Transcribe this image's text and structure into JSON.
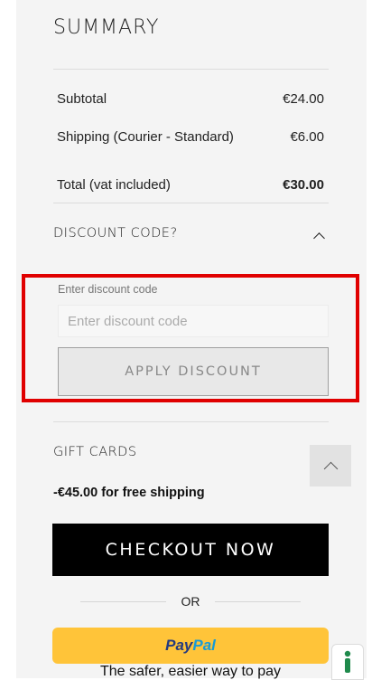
{
  "summary": {
    "title": "SUMMARY",
    "rows": [
      {
        "label": "Subtotal",
        "value": "€24.00"
      },
      {
        "label": "Shipping (Courier - Standard)",
        "value": "€6.00"
      }
    ],
    "total": {
      "label": "Total (vat included)",
      "value": "€30.00"
    }
  },
  "discount": {
    "section_label": "DISCOUNT CODE?",
    "expanded": true,
    "input_label": "Enter discount code",
    "input_placeholder": "Enter discount code",
    "input_value": "",
    "apply_label": "APPLY DISCOUNT"
  },
  "gift_cards": {
    "section_label": "GIFT CARDS",
    "expanded": false
  },
  "free_shipping_note": "-€45.00 for free shipping",
  "checkout": {
    "label": "CHECKOUT NOW"
  },
  "divider_text": "OR",
  "paypal": {
    "brand_pay": "Pay",
    "brand_pal": "Pal",
    "tagline": "The safer, easier way to pay"
  },
  "icons": {
    "discount_toggle": "chevron-up-icon",
    "gift_toggle": "chevron-down-icon",
    "scroll_top": "chevron-up-icon",
    "accessibility": "accessibility-icon"
  },
  "colors": {
    "panel_bg": "#f4f4f4",
    "highlight_box": "#e00000",
    "checkout_bg": "#000000",
    "paypal_bg": "#ffc439",
    "paypal_dark": "#253b80",
    "paypal_light": "#179bd7",
    "accessibility_accent": "#1f8a4c"
  }
}
